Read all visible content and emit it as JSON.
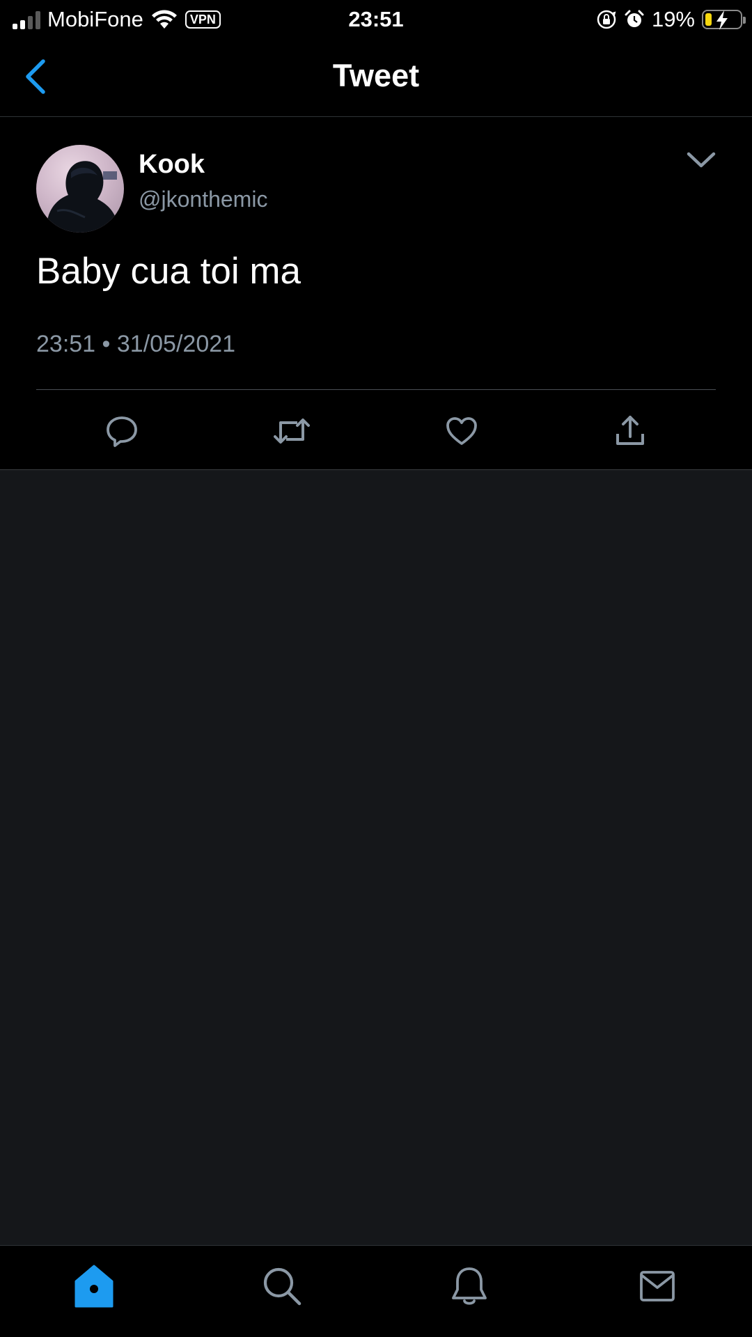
{
  "status_bar": {
    "carrier": "MobiFone",
    "vpn": "VPN",
    "time": "23:51",
    "battery_percent": "19%",
    "battery_level": 0.19,
    "battery_color": "#f7d80e"
  },
  "header": {
    "title": "Tweet",
    "back_icon": "chevron-left-icon",
    "accent_color": "#1d9bf0"
  },
  "tweet": {
    "author_name": "Kook",
    "author_handle": "@jkonthemic",
    "text": "Baby cua toi ma",
    "timestamp": "23:51 • 31/05/2021",
    "more_icon": "chevron-down-icon",
    "actions": [
      "reply-icon",
      "retweet-icon",
      "like-icon",
      "share-icon"
    ]
  },
  "tab_bar": {
    "tabs": [
      "home-icon",
      "search-icon",
      "notifications-icon",
      "messages-icon"
    ],
    "active": "home-icon"
  }
}
